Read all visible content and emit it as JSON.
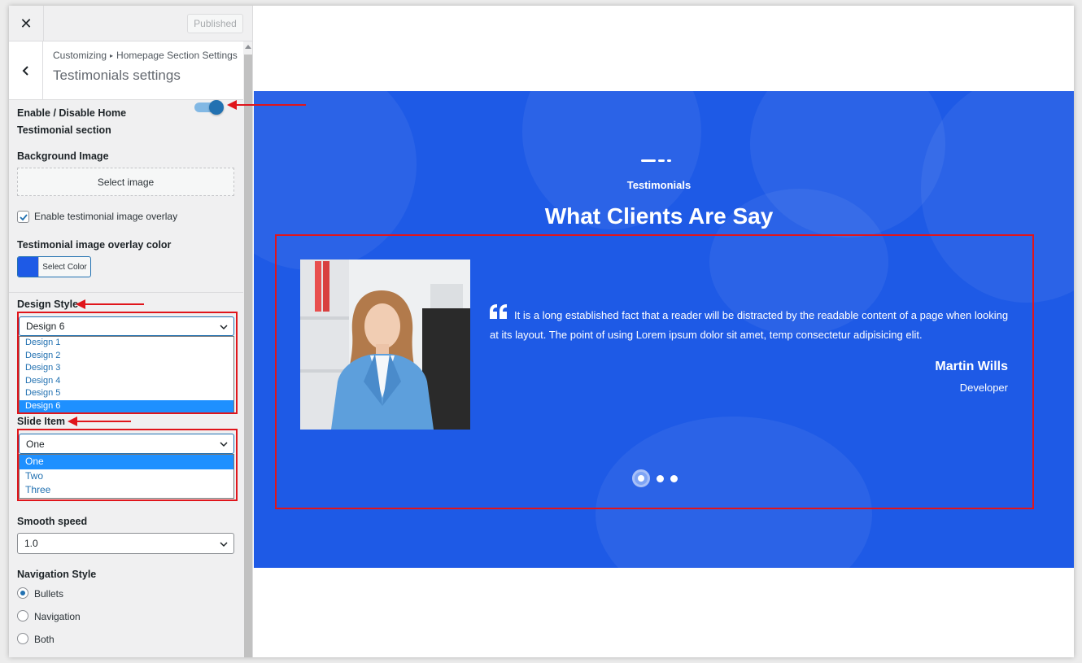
{
  "topbar": {
    "close_glyph": "✕",
    "published_label": "Published"
  },
  "header": {
    "breadcrumb_root": "Customizing",
    "breadcrumb_separator": "▸",
    "breadcrumb_section": "Homepage Section Settings",
    "title": "Testimonials settings"
  },
  "controls": {
    "enable_label": "Enable / Disable Home Testimonial section",
    "enable_on": true,
    "background_image_label": "Background Image",
    "select_image_label": "Select image",
    "overlay_checkbox_label": "Enable testimonial image overlay",
    "overlay_checked": true,
    "overlay_color_label": "Testimonial image overlay color",
    "overlay_color": "#1e5ae6",
    "select_color_label": "Select Color",
    "design_style": {
      "label": "Design Style",
      "selected": "Design 6",
      "options": [
        "Design 1",
        "Design 2",
        "Design 3",
        "Design 4",
        "Design 5",
        "Design 6"
      ]
    },
    "slide_item": {
      "label": "Slide Item",
      "selected": "One",
      "options": [
        "One",
        "Two",
        "Three"
      ]
    },
    "smooth_speed": {
      "label": "Smooth speed",
      "selected": "1.0"
    },
    "navigation_style": {
      "label": "Navigation Style",
      "options": [
        "Bullets",
        "Navigation",
        "Both"
      ],
      "selected": "Bullets"
    }
  },
  "preview": {
    "subtitle": "Testimonials",
    "title": "What Clients Are Say",
    "quote": "It is a long established fact that a reader will be distracted by the readable content of a page when looking at its layout. The point of using Lorem ipsum dolor sit amet, temp consectetur adipisicing elit.",
    "author": "Martin Wills",
    "role": "Developer",
    "background_color": "#1e5ae6",
    "active_dot": 1,
    "dot_count": 3
  },
  "colors": {
    "accent": "#2271b1",
    "annotation_red": "#e0151b"
  }
}
